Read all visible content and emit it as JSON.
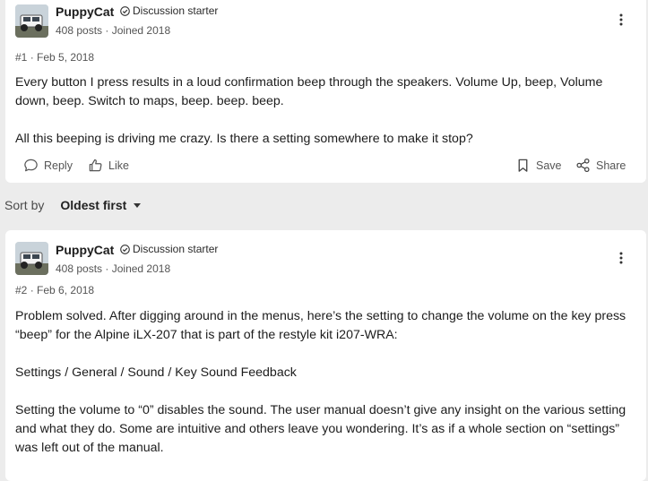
{
  "posts": [
    {
      "username": "PuppyCat",
      "badge": "Discussion starter",
      "posts_count": "408 posts",
      "separator": "·",
      "joined": "Joined 2018",
      "post_number": "#1",
      "date": "Feb 5, 2018",
      "paragraphs": [
        "Every button I press results in a loud confirmation beep through the speakers. Volume Up, beep, Volume down, beep. Switch to maps, beep. beep. beep.",
        "All this beeping is driving me crazy. Is there a setting somewhere to make it stop?"
      ],
      "actions": {
        "reply": "Reply",
        "like": "Like",
        "save": "Save",
        "share": "Share"
      }
    },
    {
      "username": "PuppyCat",
      "badge": "Discussion starter",
      "posts_count": "408 posts",
      "separator": "·",
      "joined": "Joined 2018",
      "post_number": "#2",
      "date": "Feb 6, 2018",
      "paragraphs": [
        "Problem solved. After digging around in the menus, here’s the setting to change the volume on the key press “beep” for the Alpine iLX-207 that is part of the restyle kit i207-WRA:",
        "Settings / General / Sound / Key Sound Feedback",
        "Setting the volume to “0” disables the sound. The user manual doesn’t give any insight on the various setting and what they do. Some are intuitive and others leave you wondering. It’s as if a whole section on “settings” was left out of the manual."
      ]
    }
  ],
  "sort": {
    "label": "Sort by",
    "value": "Oldest first"
  },
  "icons": {
    "verified": "check-circle-icon",
    "more": "kebab-menu-icon",
    "reply": "speech-bubble-icon",
    "like": "thumbs-up-icon",
    "save": "bookmark-icon",
    "share": "share-nodes-icon",
    "sort_caret": "caret-down-icon"
  },
  "colors": {
    "page_background": "#ececec",
    "card_background": "#ffffff",
    "text": "#1c1c1c",
    "muted": "#555555"
  }
}
